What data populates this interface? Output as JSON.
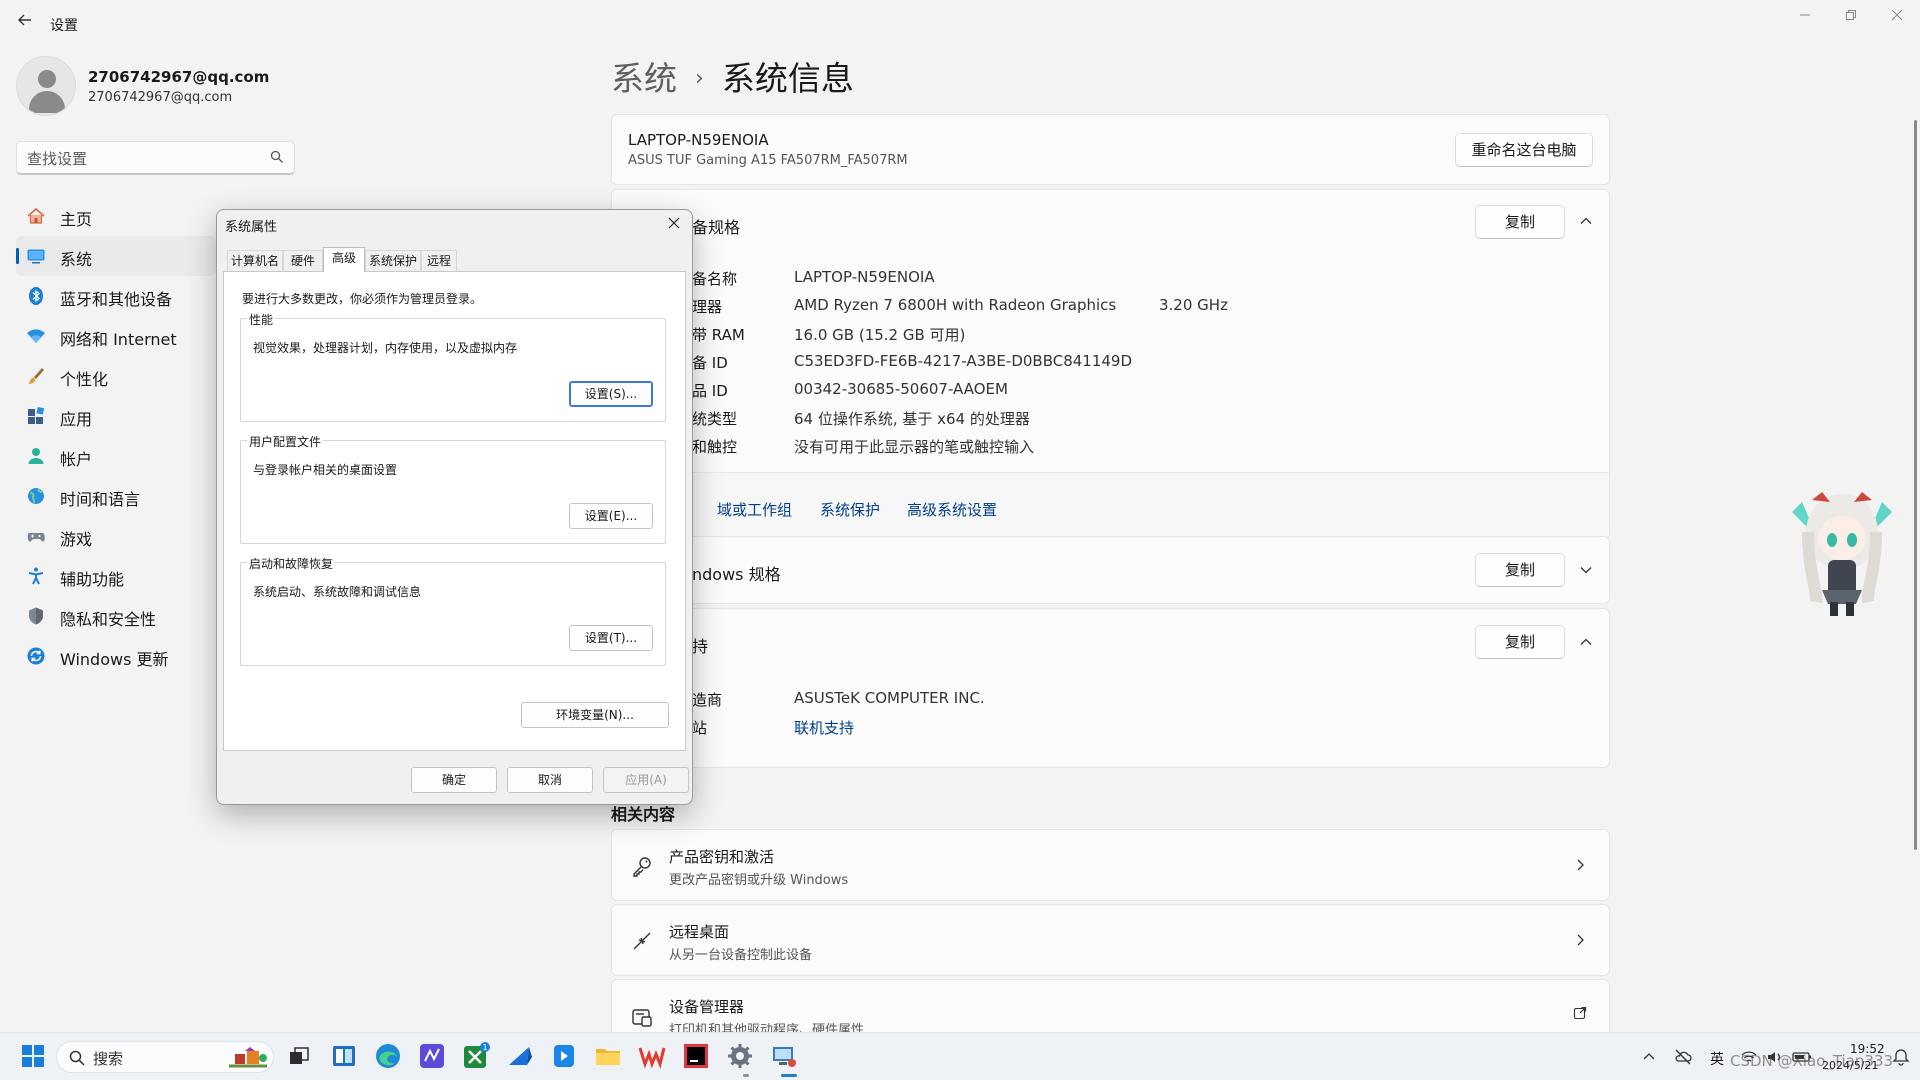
{
  "window": {
    "title": "设置"
  },
  "profile": {
    "name": "2706742967@qq.com",
    "email": "2706742967@qq.com"
  },
  "search": {
    "placeholder": "查找设置"
  },
  "sidebar": {
    "items": [
      {
        "label": "主页",
        "icon": "home-icon"
      },
      {
        "label": "系统",
        "icon": "system-icon",
        "active": true
      },
      {
        "label": "蓝牙和其他设备",
        "icon": "bluetooth-icon"
      },
      {
        "label": "网络和 Internet",
        "icon": "wifi-icon"
      },
      {
        "label": "个性化",
        "icon": "brush-icon"
      },
      {
        "label": "应用",
        "icon": "apps-icon"
      },
      {
        "label": "帐户",
        "icon": "account-icon"
      },
      {
        "label": "时间和语言",
        "icon": "globe-icon"
      },
      {
        "label": "游戏",
        "icon": "gamepad-icon"
      },
      {
        "label": "辅助功能",
        "icon": "accessibility-icon"
      },
      {
        "label": "隐私和安全性",
        "icon": "shield-icon"
      },
      {
        "label": "Windows 更新",
        "icon": "update-icon"
      }
    ]
  },
  "breadcrumb": {
    "parent": "系统",
    "separator": "›",
    "current": "系统信息"
  },
  "device": {
    "name": "LAPTOP-N59ENOIA",
    "model": "ASUS TUF Gaming A15 FA507RM_FA507RM",
    "rename_label": "重命名这台电脑"
  },
  "device_spec": {
    "title": "备规格",
    "copy_label": "复制",
    "rows": [
      {
        "label": "备名称",
        "value": "LAPTOP-N59ENOIA",
        "extra": ""
      },
      {
        "label": "理器",
        "value": "AMD Ryzen 7 6800H with Radeon Graphics",
        "extra": "3.20 GHz"
      },
      {
        "label": "带 RAM",
        "value": "16.0 GB (15.2 GB 可用)",
        "extra": ""
      },
      {
        "label": "备 ID",
        "value": "C53ED3FD-FE6B-4217-A3BE-D0BBC841149D",
        "extra": ""
      },
      {
        "label": "品 ID",
        "value": "00342-30685-50607-AAOEM",
        "extra": ""
      },
      {
        "label": "统类型",
        "value": "64 位操作系统, 基于 x64 的处理器",
        "extra": ""
      },
      {
        "label": "和触控",
        "value": "没有可用于此显示器的笔或触控输入",
        "extra": ""
      }
    ],
    "links": [
      "域或工作组",
      "系统保护",
      "高级系统设置"
    ]
  },
  "windows_spec": {
    "title": "ndows 规格",
    "copy_label": "复制"
  },
  "support": {
    "title": "持",
    "copy_label": "复制",
    "rows": [
      {
        "label": "造商",
        "value": "ASUSTeK COMPUTER INC."
      },
      {
        "label": "站",
        "value": "联机支持"
      }
    ]
  },
  "related": {
    "title": "相关内容",
    "items": [
      {
        "title": "产品密钥和激活",
        "subtitle": "更改产品密钥或升级 Windows",
        "icon": "key-icon"
      },
      {
        "title": "远程桌面",
        "subtitle": "从另一台设备控制此设备",
        "icon": "remote-desktop-icon"
      },
      {
        "title": "设备管理器",
        "subtitle": "打印机和其他驱动程序、硬件属性",
        "icon": "device-manager-icon"
      }
    ]
  },
  "dialog": {
    "title": "系统属性",
    "tabs": [
      "计算机名",
      "硬件",
      "高级",
      "系统保护",
      "远程"
    ],
    "active_tab": "高级",
    "admin_note": "要进行大多数更改，你必须作为管理员登录。",
    "groups": [
      {
        "title": "性能",
        "desc": "视觉效果，处理器计划，内存使用，以及虚拟内存",
        "button": "设置(S)..."
      },
      {
        "title": "用户配置文件",
        "desc": "与登录帐户相关的桌面设置",
        "button": "设置(E)..."
      },
      {
        "title": "启动和故障恢复",
        "desc": "系统启动、系统故障和调试信息",
        "button": "设置(T)..."
      }
    ],
    "env_button": "环境变量(N)...",
    "ok": "确定",
    "cancel": "取消",
    "apply": "应用(A)"
  },
  "taskbar": {
    "search_label": "搜索",
    "badge_count": "1",
    "tray": {
      "ime": "英",
      "time": "19:52",
      "date": "2024/5/21"
    }
  },
  "watermark": "CSDN @Xiao_Tian333",
  "colors": {
    "accent": "#005fb8",
    "link": "#003e92",
    "background": "#f3f3f3",
    "card": "#fbfbfb"
  }
}
